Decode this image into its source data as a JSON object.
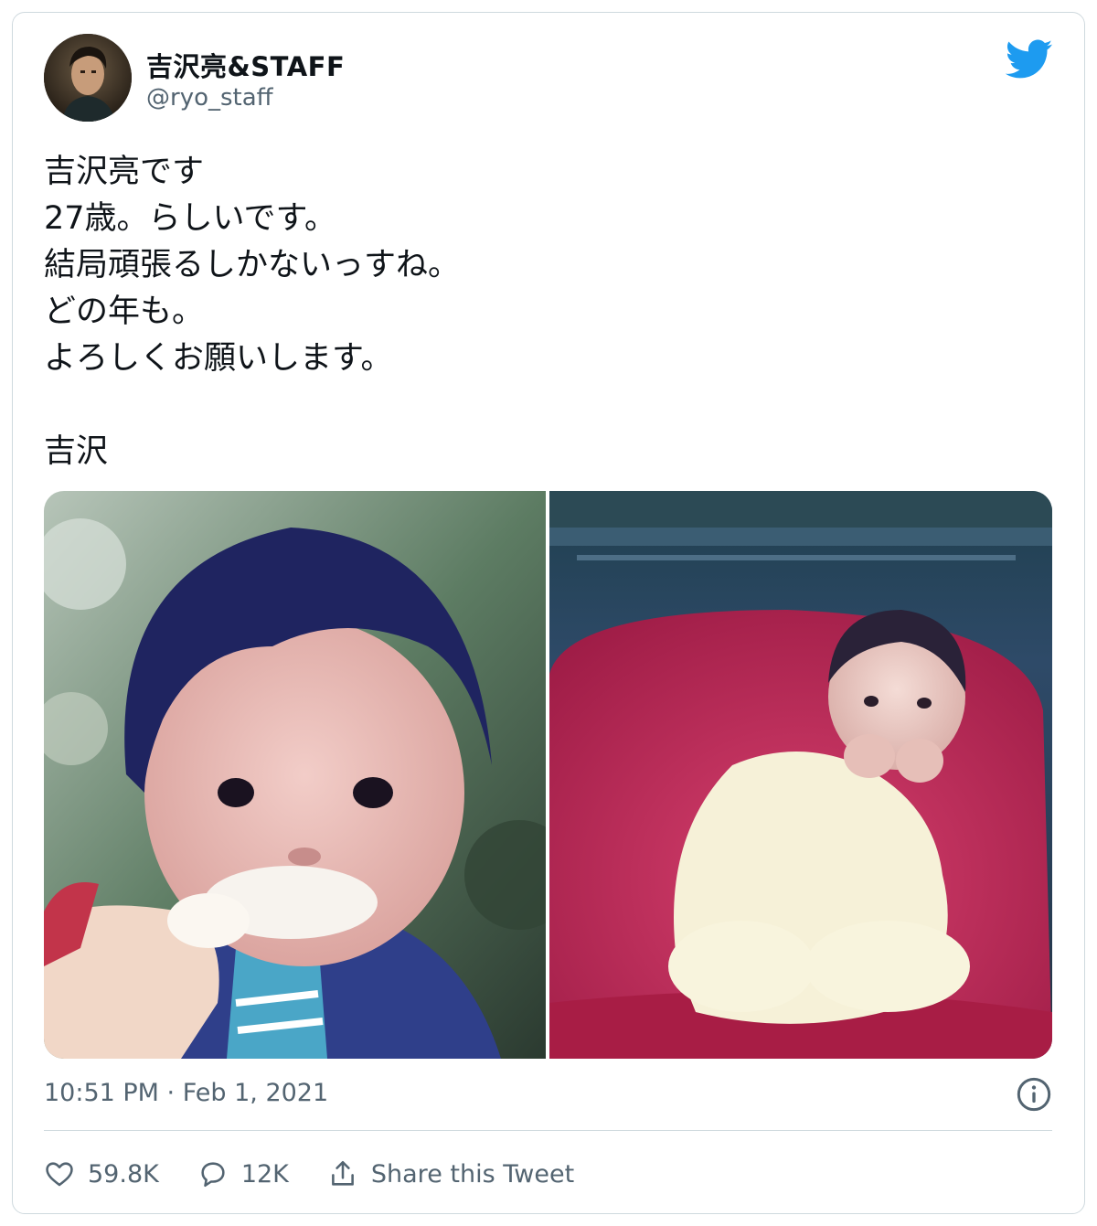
{
  "tweet": {
    "display_name": "吉沢亮&STAFF",
    "handle": "@ryo_staff",
    "lines": [
      "吉沢亮です",
      "27歳。らしいです。",
      "結局頑張るしかないっすね。",
      "どの年も。",
      "よろしくお願いします。",
      "",
      "吉沢"
    ],
    "timestamp": "10:51 PM · Feb 1, 2021",
    "likes": "59.8K",
    "replies": "12K",
    "share_label": "Share this Tweet"
  },
  "icons": {
    "brand": "twitter-bird-icon",
    "info": "info-icon",
    "like": "heart-icon",
    "reply": "speech-bubble-icon",
    "share": "share-upload-icon"
  },
  "colors": {
    "twitter_blue": "#1d9bf0",
    "text_primary": "#0f1419",
    "text_secondary": "#536471",
    "border": "#cfd9de"
  }
}
